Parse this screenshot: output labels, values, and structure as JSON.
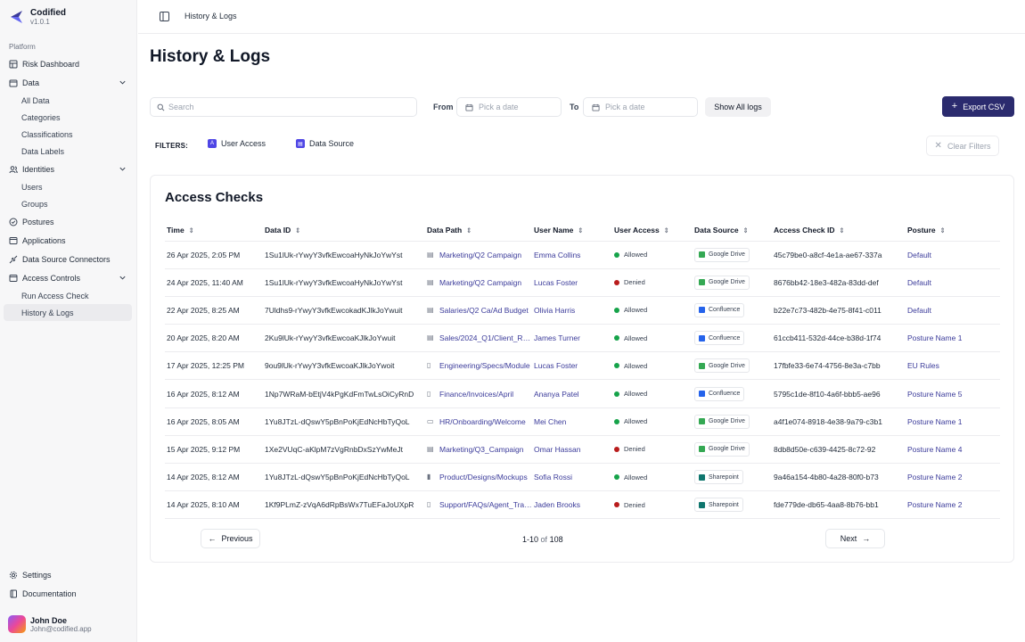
{
  "app": {
    "name": "Codified",
    "version": "v1.0.1"
  },
  "sidebar": {
    "section_label": "Platform",
    "risk_dashboard": "Risk Dashboard",
    "data": {
      "label": "Data",
      "items": [
        "All Data",
        "Categories",
        "Classifications",
        "Data Labels"
      ]
    },
    "identities": {
      "label": "Identities",
      "items": [
        "Users",
        "Groups"
      ]
    },
    "postures": "Postures",
    "applications": "Applications",
    "connectors": "Data Source Connectors",
    "access_controls": {
      "label": "Access Controls",
      "items": [
        "Run Access Check",
        "History & Logs"
      ]
    },
    "settings": "Settings",
    "documentation": "Documentation",
    "user": {
      "name": "John Doe",
      "email": "John@codified.app"
    }
  },
  "header": {
    "breadcrumb": "History & Logs"
  },
  "page": {
    "title": "History & Logs"
  },
  "toolbar": {
    "search_placeholder": "Search",
    "from_label": "From",
    "to_label": "To",
    "date_placeholder": "Pick a date",
    "show_all": "Show All logs",
    "export": "Export CSV"
  },
  "filters": {
    "label": "FILTERS:",
    "chips": [
      "User Access",
      "Data Source"
    ],
    "clear": "Clear Filters"
  },
  "table": {
    "title": "Access Checks",
    "columns": [
      "Time",
      "Data ID",
      "Data Path",
      "User Name",
      "User Access",
      "Data Source",
      "Access Check ID",
      "Posture"
    ],
    "rows": [
      {
        "time": "26 Apr 2025, 2:05 PM",
        "data_id": "1Su1lUk-rYwyY3vfkEwcoaHyNkJoYwYst",
        "path": "Marketing/Q2 Campaign",
        "path_icon": "sheet-icon",
        "user": "Emma Collins",
        "access": "Allowed",
        "source": "Google Drive",
        "check_id": "45c79be0-a8cf-4e1a-ae67-337a",
        "posture": "Default"
      },
      {
        "time": "24 Apr 2025, 11:40 AM",
        "data_id": "1Su1lUk-rYwyY3vfkEwcoaHyNkJoYwYst",
        "path": "Marketing/Q2 Campaign",
        "path_icon": "sheet-icon",
        "user": "Lucas Foster",
        "access": "Denied",
        "source": "Google Drive",
        "check_id": "8676bb42-18e3-482a-83dd-def",
        "posture": "Default"
      },
      {
        "time": "22 Apr 2025, 8:25 AM",
        "data_id": "7Uldhs9-rYwyY3vfkEwcokadKJlkJoYwuit",
        "path": "Salaries/Q2 Ca/Ad Budget",
        "path_icon": "sheet-icon",
        "user": "Olivia Harris",
        "access": "Allowed",
        "source": "Confluence",
        "check_id": "b22e7c73-482b-4e75-8f41-c011",
        "posture": "Default"
      },
      {
        "time": "20 Apr 2025, 8:20 AM",
        "data_id": "2Ku9lUk-rYwyY3vfkEwcoaKJlkJoYwuit",
        "path": "Sales/2024_Q1/Client_Report",
        "path_icon": "sheet-icon",
        "user": "James Turner",
        "access": "Allowed",
        "source": "Confluence",
        "check_id": "61ccb411-532d-44ce-b38d-1f74",
        "posture": "Posture Name 1"
      },
      {
        "time": "17 Apr 2025, 12:25 PM",
        "data_id": "9ou9lUk-rYwyY3vfkEwcoaKJlkJoYwoit",
        "path": "Engineering/Specs/Module",
        "path_icon": "doc-icon",
        "user": "Lucas Foster",
        "access": "Allowed",
        "source": "Google Drive",
        "check_id": "17fbfe33-6e74-4756-8e3a-c7bb",
        "posture": "EU Rules"
      },
      {
        "time": "16 Apr 2025, 8:12 AM",
        "data_id": "1Np7WRaM-bEtjV4kPgKdFmTwLsOiCyRnD",
        "path": "Finance/Invoices/April",
        "path_icon": "doc-icon",
        "user": "Ananya Patel",
        "access": "Allowed",
        "source": "Confluence",
        "check_id": "5795c1de-8f10-4a6f-bbb5-ae96",
        "posture": "Posture Name 5"
      },
      {
        "time": "16 Apr 2025, 8:05 AM",
        "data_id": "1Yu8JTzL-dQswY5pBnPoKjEdNcHbTyQoL",
        "path": "HR/Onboarding/Welcome",
        "path_icon": "slides-icon",
        "user": "Mei Chen",
        "access": "Allowed",
        "source": "Google Drive",
        "check_id": "a4f1e074-8918-4e38-9a79-c3b1",
        "posture": "Posture Name 1"
      },
      {
        "time": "15 Apr 2025, 9:12 PM",
        "data_id": "1Xe2VUqC-aKlpM7zVgRnbDxSzYwMeJt",
        "path": "Marketing/Q3_Campaign",
        "path_icon": "sheet-icon",
        "user": "Omar Hassan",
        "access": "Denied",
        "source": "Google Drive",
        "check_id": "8db8d50e-c639-4425-8c72-92",
        "posture": "Posture Name 4"
      },
      {
        "time": "14 Apr 2025, 8:12 AM",
        "data_id": "1Yu8JTzL-dQswY5pBnPoKjEdNcHbTyQoL",
        "path": "Product/Designs/Mockups",
        "path_icon": "file-icon",
        "user": "Sofia Rossi",
        "access": "Allowed",
        "source": "Sharepoint",
        "check_id": "9a46a154-4b80-4a28-80f0-b73",
        "posture": "Posture Name 2"
      },
      {
        "time": "14 Apr 2025, 8:10 AM",
        "data_id": "1Kf9PLmZ-zVqA6dRpBsWx7TuEFaJoUXpR",
        "path": "Support/FAQs/Agent_Training",
        "path_icon": "doc-icon",
        "user": "Jaden Brooks",
        "access": "Denied",
        "source": "Sharepoint",
        "check_id": "fde779de-db65-4aa8-8b76-bb1",
        "posture": "Posture Name 2"
      }
    ]
  },
  "pagination": {
    "previous": "Previous",
    "next": "Next",
    "range": "1-10",
    "of": "of",
    "total": "108"
  },
  "colors": {
    "primary": "#2b2b6e",
    "link": "#3b3b9a",
    "allowed": "#16a34a",
    "denied": "#b91c1c",
    "google_drive": "#34a853",
    "confluence": "#2563eb",
    "sharepoint": "#0f766e"
  }
}
